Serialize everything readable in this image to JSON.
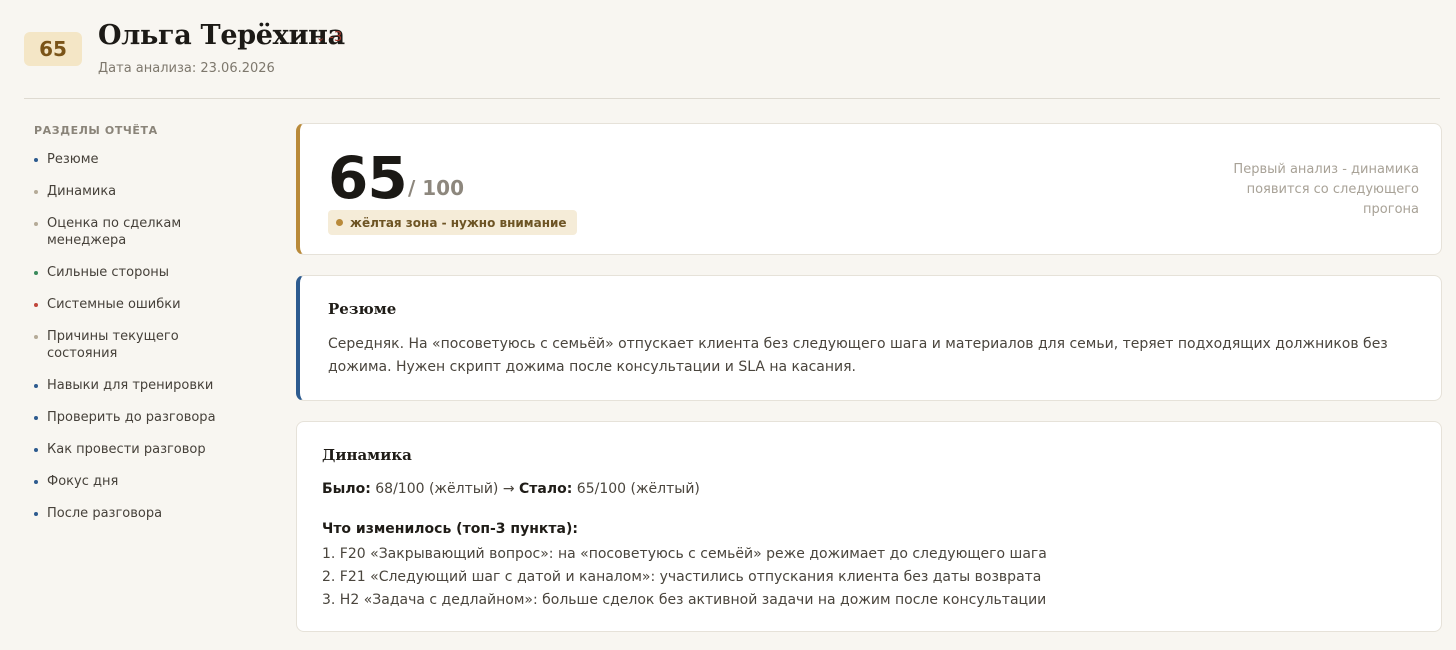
{
  "header": {
    "score": "65",
    "name": "Ольга Терёхина",
    "delta": "-3",
    "date": "Дата анализа: 23.06.2026"
  },
  "sidebar": {
    "title": "РАЗДЕЛЫ ОТЧЁТА",
    "items": [
      {
        "label": "Резюме",
        "dot": "#2d5b8f"
      },
      {
        "label": "Динамика",
        "dot": "#b5ab98"
      },
      {
        "label": "Оценка по сделкам менеджера",
        "dot": "#b5ab98"
      },
      {
        "label": "Сильные стороны",
        "dot": "#3a8a5b"
      },
      {
        "label": "Системные ошибки",
        "dot": "#c0463a"
      },
      {
        "label": "Причины текущего состояния",
        "dot": "#b5ab98"
      },
      {
        "label": "Навыки для тренировки",
        "dot": "#2d5b8f"
      },
      {
        "label": "Проверить до разговора",
        "dot": "#2d5b8f"
      },
      {
        "label": "Как провести разговор",
        "dot": "#2d5b8f"
      },
      {
        "label": "Фокус дня",
        "dot": "#2d5b8f"
      },
      {
        "label": "После разговора",
        "dot": "#2d5b8f"
      }
    ]
  },
  "score_card": {
    "value": "65",
    "max": "/ 100",
    "zone": "жёлтая зона - нужно внимание",
    "note": "Первый анализ - динамика появится со следующего прогона"
  },
  "resume": {
    "title": "Резюме",
    "text": "Середняк. На «посоветуюсь с семьёй» отпускает клиента без следующего шага и материалов для семьи, теряет подходящих должников без дожима. Нужен скрипт дожима после консультации и SLA на касания."
  },
  "dynamics": {
    "title": "Динамика",
    "was_label": "Было:",
    "was_value": "68/100 (жёлтый)",
    "arrow": "→",
    "now_label": "Стало:",
    "now_value": "65/100 (жёлтый)",
    "changes_title": "Что изменилось (топ-3 пункта):",
    "changes": [
      "1. F20 «Закрывающий вопрос»: на «посоветуюсь с семьёй» реже дожимает до следующего шага",
      "2. F21 «Следующий шаг с датой и каналом»: участились отпускания клиента без даты возврата",
      "3. H2 «Задача с дедлайном»: больше сделок без активной задачи на дожим после консультации"
    ]
  },
  "colors": {
    "accent_gold": "#b98a3a",
    "accent_blue": "#2d5b8f",
    "delta_red": "#a0392e"
  }
}
